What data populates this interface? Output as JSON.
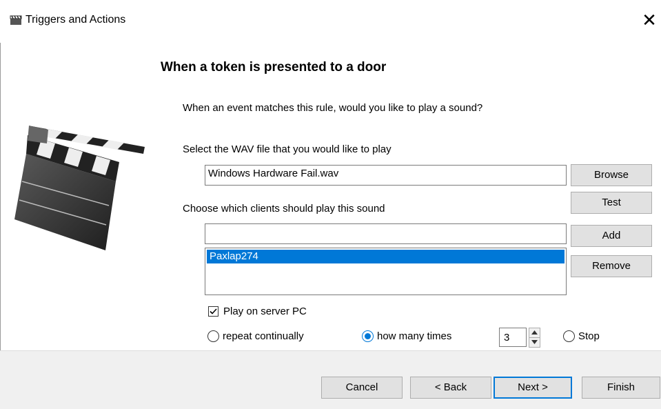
{
  "window": {
    "title": "Triggers and Actions",
    "close_glyph": "✕"
  },
  "heading": "When a token is presented to a door",
  "question": "When an event matches this rule, would you like to play a sound?",
  "wav": {
    "label": "Select the WAV file that you would like to play",
    "value": "Windows Hardware Fail.wav",
    "browse_label": "Browse",
    "test_label": "Test"
  },
  "clients": {
    "label": "Choose which clients should play this sound",
    "input_value": "",
    "add_label": "Add",
    "remove_label": "Remove",
    "items": [
      "Paxlap274"
    ]
  },
  "play_on_server": {
    "label": "Play on server PC",
    "checked": true
  },
  "repeat": {
    "continually_label": "repeat continually",
    "times_label": "how many times",
    "times_value": "3",
    "stop_label": "Stop",
    "selected": "how many times"
  },
  "footer": {
    "cancel_label": "Cancel",
    "back_label": "< Back",
    "next_label": "Next >",
    "finish_label": "Finish"
  },
  "icons": {
    "app": "clapperboard-icon",
    "illustration": "clapperboard-illustration",
    "close": "close-icon",
    "spin_up": "chevron-up-icon",
    "spin_down": "chevron-down-icon"
  },
  "colors": {
    "accent": "#0078d7",
    "footer_bg": "#f0f0f0",
    "button_bg": "#e1e1e1"
  }
}
